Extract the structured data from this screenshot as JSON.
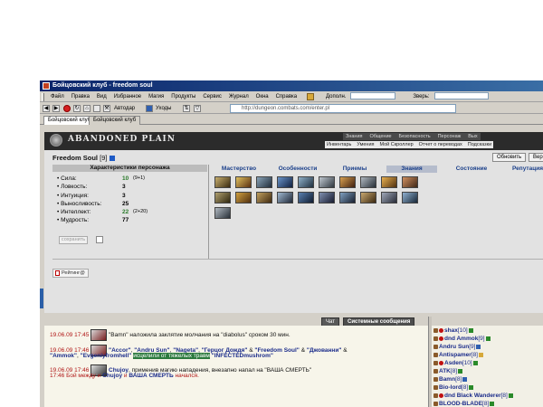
{
  "window": {
    "title": "Бойцовский клуб - freedom soul"
  },
  "menu": {
    "items": [
      "Файл",
      "Правка",
      "Вид",
      "Избранное",
      "Магия",
      "Продукты",
      "Сервис",
      "Журнал",
      "Окна",
      "Справка"
    ],
    "dopoln_label": "Дополн.",
    "zvere_label": "Зверь:"
  },
  "toolbar": {
    "autodar": "Автодар",
    "uhoty": "Уходы",
    "address": "http://dungeon.combats.com/enter.pl"
  },
  "browser_tabs": [
    "Бойцовский клуб",
    "Бойцовский клуб"
  ],
  "game": {
    "location_title": "ABANDONED PLAIN",
    "top_menu": [
      "Знания",
      "Общение",
      "Безопасность",
      "Персонаж",
      "Вых"
    ],
    "sub_menu": [
      "Инвентарь",
      "Умения",
      "Мой Скроллер",
      "Отчет о переводах",
      "Подсказки"
    ],
    "char_name": "Freedom Soul",
    "char_level": "[9]",
    "btn_update": "Обновить",
    "btn_back": "Верн",
    "stats_header": "Характеристики персонажа",
    "stats": [
      {
        "name": "• Сила:",
        "value": "10",
        "bonus": "(9+1)",
        "green": true
      },
      {
        "name": "• Ловкость:",
        "value": "3",
        "bonus": "",
        "green": false
      },
      {
        "name": "• Интуиция:",
        "value": "3",
        "bonus": "",
        "green": false
      },
      {
        "name": "• Выносливость:",
        "value": "25",
        "bonus": "",
        "green": false
      },
      {
        "name": "• Интеллект:",
        "value": "22",
        "bonus": "(2+20)",
        "green": true
      },
      {
        "name": "• Мудрость:",
        "value": "77",
        "bonus": "",
        "green": false
      }
    ],
    "save_btn": "сохранить",
    "skill_tabs": [
      "Мастерство",
      "Особенности",
      "Приемы",
      "Знания",
      "Состояние",
      "Репутация"
    ],
    "active_skill_tab": "Знания",
    "rating_label": "Рейтинг@"
  },
  "chat": {
    "tabs": [
      "Чат",
      "Системные сообщения"
    ],
    "messages": {
      "m1_time": "19.06.09 17:45",
      "m1_text": " \"Bamn\" наложила заклятие молчания на \"diabolus\" сроком 30 мин.",
      "m2_time": "19.06.09 17:46",
      "m2_n1": "\"Accor\"",
      "m2_n2": "\"Andru Sun\"",
      "m2_n3": "\"Nageta\"",
      "m2_n4": "\"Герцог Дождя\"",
      "m2_n5": "\"Freedom Soul\"",
      "m2_n6": "\"Джованни\"",
      "m2_n7": "\"Ammok\"",
      "m2_n8": "\"Evgeniyfromhell\"",
      "m2_hl": "исцелили от тяжелых травм",
      "m2_n9": "\"INFECTEDmushrom\"",
      "m3_time": "19.06.09 17:46",
      "m3_nick": "Chujoy",
      "m3_text": ", применив магию нападения, внезапно напал на \"ВАША СМЕРТЬ\"",
      "m4_time": "17:46",
      "m4_text1": " Бой между и ",
      "m4_nick": "Chujoy",
      "m4_text2": " и ",
      "m4_nick2": "ВАША СМЕРТЬ",
      "m4_text3": " начался."
    }
  },
  "users": [
    {
      "name": "shax",
      "level": "[10]"
    },
    {
      "name": "dnd Ammok",
      "level": "[9]"
    },
    {
      "name": "Andru Sun",
      "level": "[9]"
    },
    {
      "name": "Antispamer",
      "level": "[8]"
    },
    {
      "name": "Asden",
      "level": "[10]"
    },
    {
      "name": "ATK",
      "level": "[8]"
    },
    {
      "name": "Bamn",
      "level": "[8]"
    },
    {
      "name": "Bio-lord",
      "level": "[8]"
    },
    {
      "name": "dnd Black Wanderer",
      "level": "[8]"
    },
    {
      "name": "BLOOD-BLADE",
      "level": "[8]"
    }
  ],
  "colors": {
    "title_bar": "#0a246a",
    "nick": "#1a2b8a",
    "time": "#b01515",
    "highlight": "#2c7a3e"
  }
}
